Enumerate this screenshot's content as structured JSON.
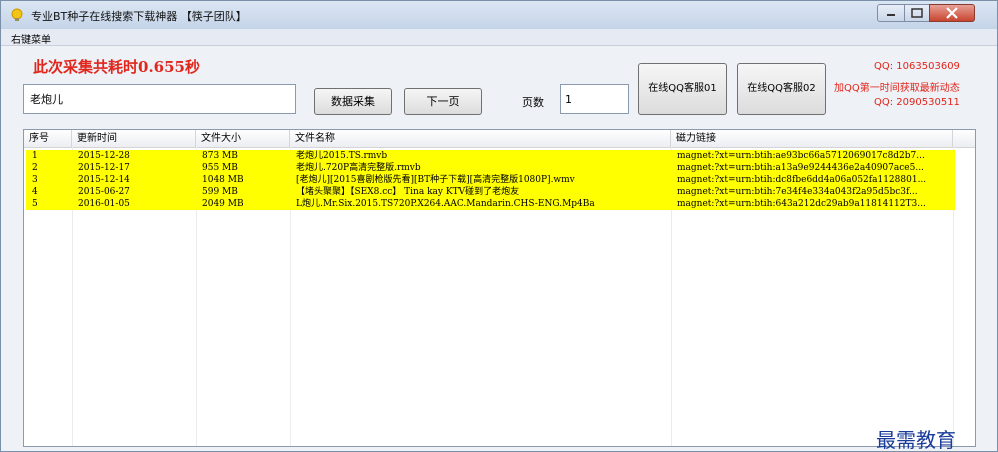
{
  "window": {
    "title": "专业BT种子在线搜索下载神器 【筷子团队】",
    "menu": {
      "right_click_menu": "右键菜单"
    }
  },
  "timing_text": "此次采集共耗时0.655秒",
  "search": {
    "value": "老炮儿"
  },
  "buttons": {
    "collect": "数据采集",
    "next_page": "下一页",
    "qq_service_1": "在线QQ客服01",
    "qq_service_2": "在线QQ客服02"
  },
  "page": {
    "label": "页数",
    "value": "1"
  },
  "contact": {
    "qq1": "QQ: 1063503609",
    "group_note": "加QQ第一时间获取最新动态",
    "qq2": "QQ: 2090530511"
  },
  "table": {
    "columns": [
      "序号",
      "更新时间",
      "文件大小",
      "文件名称",
      "磁力链接"
    ],
    "rows": [
      [
        "1",
        "2015-12-28",
        "873 MB",
        "老炮儿2015.TS.rmvb",
        "magnet:?xt=urn:btih:ae93bc66a5712069017c8d2b7..."
      ],
      [
        "2",
        "2015-12-17",
        "955 MB",
        "老炮儿.720P高清完整版.rmvb",
        "magnet:?xt=urn:btih:a13a9e9244436e2a40907ace5..."
      ],
      [
        "3",
        "2015-12-14",
        "1048 MB",
        "[老炮儿][2015喜剧枪版先看][BT种子下载][高清完整版1080P].wmv",
        "magnet:?xt=urn:btih:dc8fbe6dd4a06a052fa1128801..."
      ],
      [
        "4",
        "2015-06-27",
        "599 MB",
        "【堵头聚聚】【SEX8.cc】 Tina kay KTV碰到了老炮友",
        "magnet:?xt=urn:btih:7e34f4e334a043f2a95d5bc3f..."
      ],
      [
        "5",
        "2016-01-05",
        "2049 MB",
        "L炮儿.Mr.Six.2015.TS720P.X264.AAC.Mandarin.CHS-ENG.Mp4Ba",
        "magnet:?xt=urn:btih:643a212dc29ab9a11814112T3..."
      ]
    ]
  },
  "watermark": "最需教育",
  "colors": {
    "accent_red": "#e1261c",
    "row_highlight": "#ffff00",
    "watermark_blue": "#1a3c9a"
  },
  "icons": {
    "app": "bulb-icon",
    "minimize": "minimize-icon",
    "maximize": "maximize-icon",
    "close": "close-icon"
  }
}
